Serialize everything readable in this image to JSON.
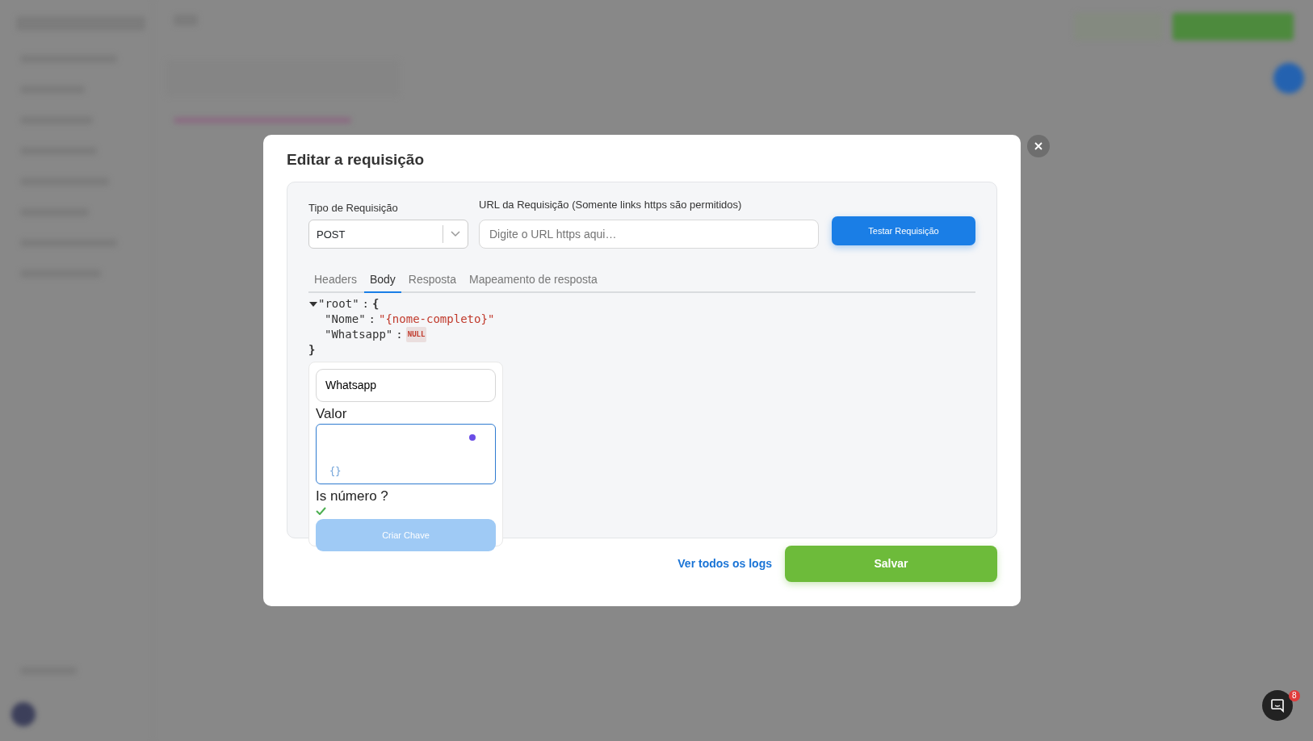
{
  "modal": {
    "title": "Editar a requisição",
    "request_type": {
      "label": "Tipo de Requisição",
      "value": "POST"
    },
    "url": {
      "label": "URL da Requisição (Somente links https são permitidos)",
      "placeholder": "Digite o URL https aqui…"
    },
    "test_button": "Testar Requisição",
    "tabs": [
      {
        "label": "Headers",
        "selected": false
      },
      {
        "label": "Body",
        "selected": true
      },
      {
        "label": "Resposta",
        "selected": false
      },
      {
        "label": "Mapeamento de resposta",
        "selected": false
      }
    ],
    "body_tree": {
      "key": "\"root\"",
      "colon": ":",
      "open": "{",
      "close": "}",
      "expanded": true,
      "children": [
        {
          "key": "\"Nome\"",
          "colon": ":",
          "kind": "string",
          "value": "\"{nome-completo}\""
        },
        {
          "key": "\"Whatsapp\"",
          "colon": ":",
          "kind": "null",
          "value": "NULL"
        }
      ]
    },
    "key_editor": {
      "key_value": "Whatsapp",
      "value_label": "Valor",
      "variable_button": "{}",
      "is_number_label": "Is número ?",
      "is_number": true,
      "create_button": {
        "label": "Criar Chave",
        "disabled": true
      }
    },
    "logs_link": "Ver todos os logs",
    "save_button": "Salvar"
  },
  "chat_widget": {
    "badge": "8"
  }
}
